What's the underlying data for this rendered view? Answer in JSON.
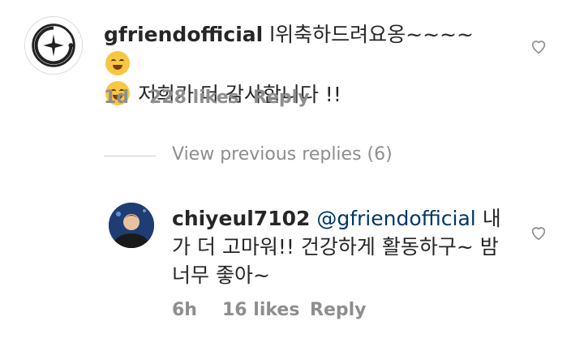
{
  "comment": {
    "username": "gfriendofficial",
    "text_line1": "l위축하드려요옹~~~~",
    "text_line2": "저희가 더 감사합니다 !!",
    "time": "1d",
    "likes": "228 likes",
    "reply_label": "Reply"
  },
  "view_previous": {
    "label": "View previous replies (6)"
  },
  "reply": {
    "username": "chiyeul7102",
    "mention": "@gfriendofficial",
    "text": " 내가 더 고마워!! 건강하게 활동하구~ 밤 너무 좋아~",
    "time": "6h",
    "likes": "16 likes",
    "reply_label": "Reply"
  },
  "icons": {
    "heart": "heart-outline-icon",
    "emoji_hug": "hugging-face-emoji",
    "emoji_smile": "smiling-face-emoji"
  },
  "colors": {
    "text": "#262626",
    "meta": "#8e8e8e",
    "mention": "#00376b",
    "emoji": "#f7c744"
  }
}
